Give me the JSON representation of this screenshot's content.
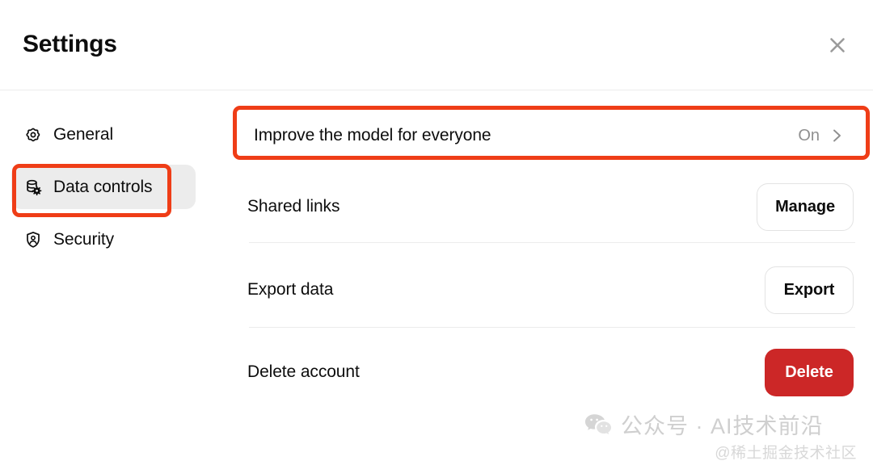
{
  "header": {
    "title": "Settings",
    "close_icon": "close-icon"
  },
  "sidebar": {
    "items": [
      {
        "label": "General",
        "icon": "gear-icon",
        "selected": false
      },
      {
        "label": "Data controls",
        "icon": "database-gear-icon",
        "selected": true
      },
      {
        "label": "Security",
        "icon": "shield-person-icon",
        "selected": false
      }
    ]
  },
  "main": {
    "rows": [
      {
        "label": "Improve the model for everyone",
        "value": "On",
        "control": "chevron-right-icon"
      },
      {
        "label": "Shared links",
        "button": "Manage",
        "button_style": "secondary"
      },
      {
        "label": "Export data",
        "button": "Export",
        "button_style": "secondary"
      },
      {
        "label": "Delete account",
        "button": "Delete",
        "button_style": "danger"
      }
    ]
  },
  "annotations": [
    {
      "name": "improve-the-model-highlight",
      "color": "#ef3d17"
    },
    {
      "name": "data-controls-highlight",
      "color": "#ef3d17"
    }
  ],
  "watermark": {
    "icon": "wechat-icon",
    "text": "公众号 · AI技术前沿",
    "subtext": "@稀土掘金技术社区"
  },
  "colors": {
    "accent_red": "#ef3d17",
    "danger_button": "#cc2727",
    "selected_bg": "#ececec",
    "muted_text": "#8f8f8f",
    "divider": "#ececec",
    "text": "#0d0d0d"
  }
}
